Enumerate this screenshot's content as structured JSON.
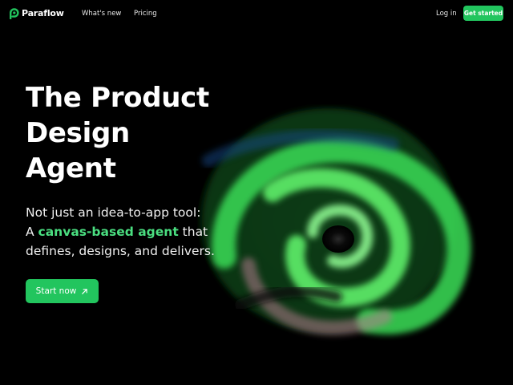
{
  "nav": {
    "brand": "Paraflow",
    "links": [
      "What's new",
      "Pricing"
    ],
    "login": "Log in",
    "cta": "Get started"
  },
  "hero": {
    "title_lines": [
      "The Product",
      "Design",
      "Agent"
    ],
    "subtitle_line1": "Not just an idea-to-app tool:",
    "subtitle_prefix": "A ",
    "subtitle_highlight": "canvas-based agent",
    "subtitle_suffix": " that",
    "subtitle_line3": "defines, designs, and delivers.",
    "cta": "Start now",
    "cta_icon": "arrow-up-right-icon"
  },
  "colors": {
    "background": "#000000",
    "accent": "#22c55e",
    "highlight_text": "#4ade80"
  },
  "icons": {
    "logo": "paraflow-logo-icon",
    "cta": "arrow-up-right-icon"
  }
}
